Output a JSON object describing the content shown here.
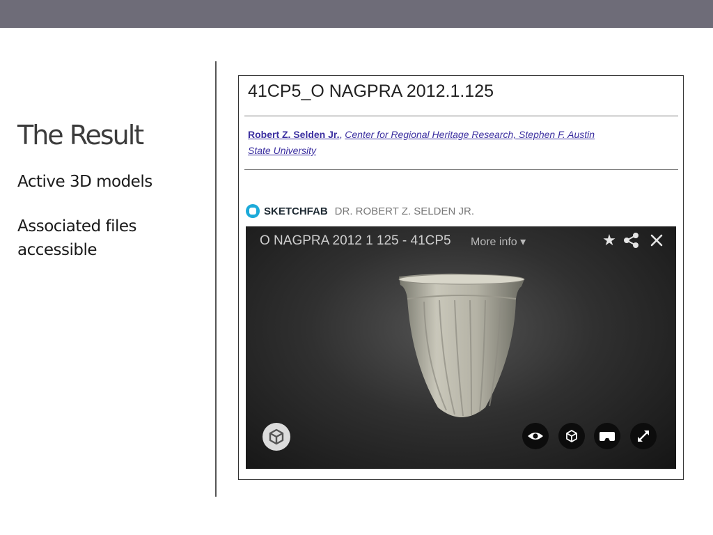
{
  "slide": {
    "title": "The Result",
    "bullets": [
      "Active 3D models",
      "Associated files accessible"
    ]
  },
  "record": {
    "title": "41CP5_O NAGPRA 2012.1.125",
    "author": "Robert Z. Selden Jr.",
    "affiliation": "Center for Regional Heritage Research, Stephen F. Austin State University"
  },
  "sketchfab": {
    "brand": "SKETCHFAB",
    "author": "DR. ROBERT Z. SELDEN JR.",
    "model_title": "O NAGPRA 2012 1 125 - 41CP5",
    "more_info": "More info ▾"
  },
  "icons": {
    "star": "star-icon",
    "share": "share-icon",
    "close": "close-icon",
    "logo": "sketchfab-logo-icon",
    "eye": "eye-icon",
    "cube": "cube-icon",
    "vr": "vr-headset-icon",
    "fullscreen": "fullscreen-icon"
  },
  "colors": {
    "top_bar": "#6e6c78",
    "link": "#3b2fa0",
    "sketchfab_blue": "#1caad9",
    "viewer_bg": "#2a2a2a"
  }
}
